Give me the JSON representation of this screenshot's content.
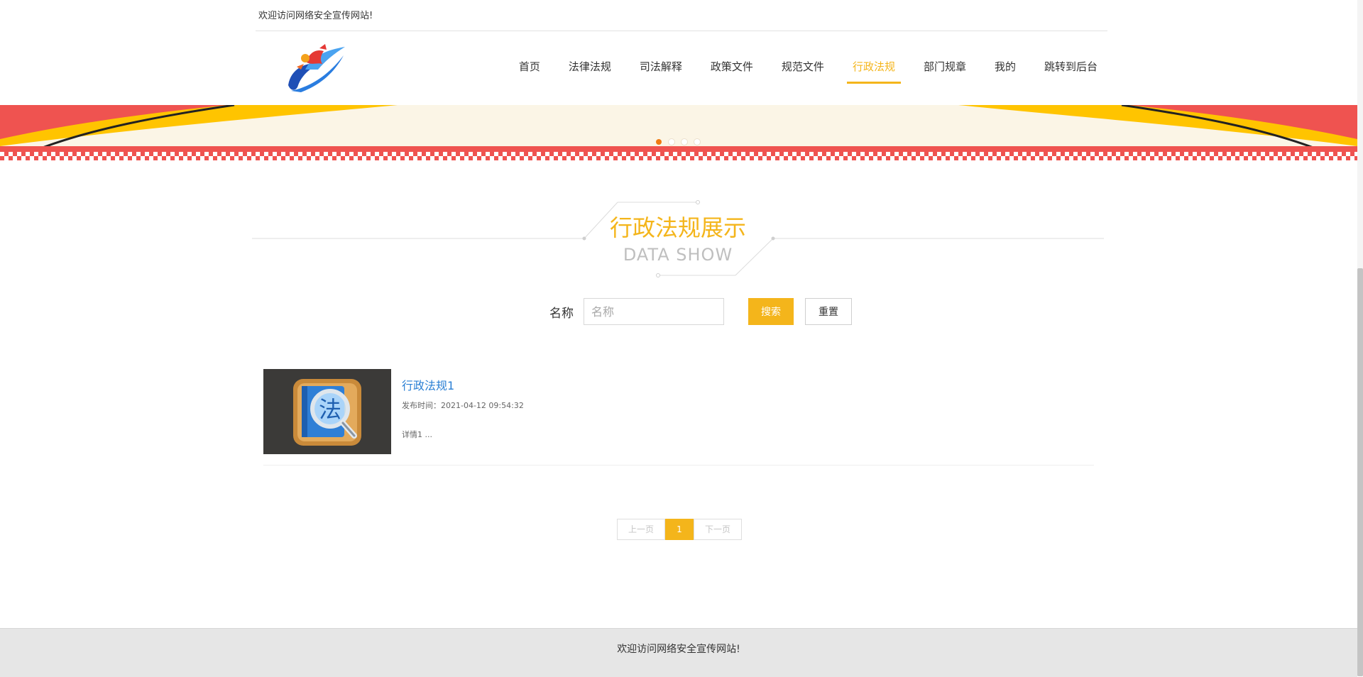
{
  "topbar": {
    "welcome": "欢迎访问网络安全宣传网站!"
  },
  "nav": {
    "items": [
      {
        "label": "首页"
      },
      {
        "label": "法律法规"
      },
      {
        "label": "司法解释"
      },
      {
        "label": "政策文件"
      },
      {
        "label": "规范文件"
      },
      {
        "label": "行政法规"
      },
      {
        "label": "部门规章"
      },
      {
        "label": "我的"
      },
      {
        "label": "跳转到后台"
      }
    ],
    "active": "行政法规"
  },
  "banner": {
    "slide_count": 4,
    "active_slide": 1
  },
  "section": {
    "title": "行政法规展示",
    "subtitle": "DATA SHOW"
  },
  "search": {
    "label": "名称",
    "placeholder": "名称",
    "value": "",
    "search_button": "搜索",
    "reset_button": "重置"
  },
  "list": {
    "items": [
      {
        "title": "行政法规1",
        "time": "发布时间：2021-04-12 09:54:32",
        "desc": "详情1 ...",
        "thumb_char": "法"
      }
    ]
  },
  "pagination": {
    "prev": "上一页",
    "current": "1",
    "next": "下一页"
  },
  "footer": {
    "text": "欢迎访问网络安全宣传网站!"
  },
  "colors": {
    "accent": "#f4b51b",
    "link": "#2a7fd4",
    "banner_red": "#ef5350",
    "banner_yellow": "#ffc400"
  }
}
